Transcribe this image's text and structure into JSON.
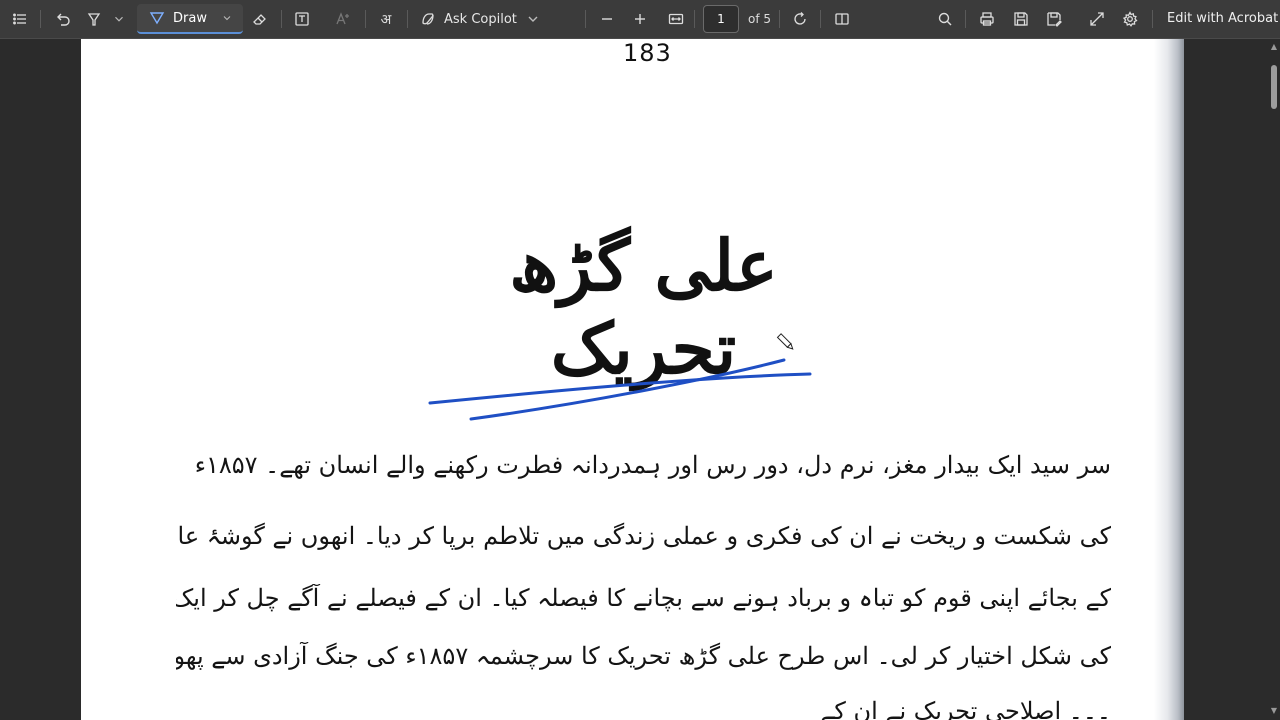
{
  "toolbar": {
    "draw_label": "Draw",
    "ask_copilot_label": "Ask Copilot",
    "page_current": "1",
    "page_total": "of 5",
    "edit_acrobat_label": "Edit with Acrobat"
  },
  "document": {
    "page_number": "183",
    "title": "علی گڑھ تحریک",
    "lines": [
      "سر سید ایک بیدار مغز، نرم دل، دور رس اور ہمدردانہ فطرت رکھنے والے انسان تھے۔ ۱۸۵۷ء",
      "کی شکست و ریخت نے ان کی فکری و عملی زندگی میں تلاطم برپا کر دیا۔ انھوں نے گوشۂ عافیت تلاش کرنے",
      "کے بجائے اپنی قوم کو تباہ و برباد ہونے سے بچانے کا فیصلہ کیا۔ ان کے فیصلے نے آگے چل کر ایک تحریک",
      "کی شکل اختیار کر لی۔ اس طرح علی گڑھ تحریک کا سرچشمہ ۱۸۵۷ء کی جنگ آزادی سے پھوٹا۔ علاوہ ازیں",
      "۔۔۔ اصلاحی تحریک نے ان کے"
    ]
  },
  "colors": {
    "ink": "#1f4fc4",
    "toolbar_bg": "#3b3b3b",
    "accent": "#5b8fd6"
  }
}
